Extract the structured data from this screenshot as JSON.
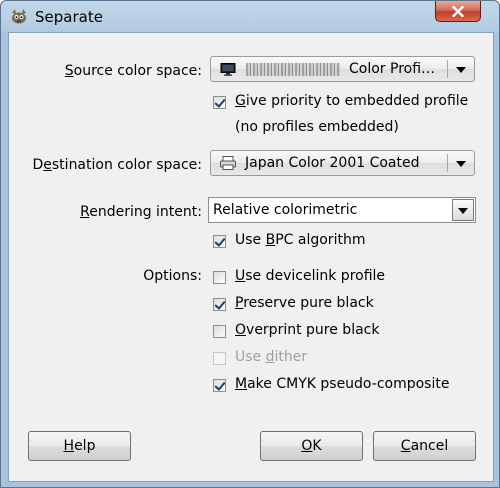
{
  "window": {
    "title": "Separate",
    "app_icon": "gimp-icon",
    "close_icon": "close-icon"
  },
  "source": {
    "label_pre": "",
    "label_u": "S",
    "label_post": "ource color space:",
    "value_suffix": "Color Profi…",
    "icon": "monitor-icon",
    "give_priority": {
      "checked": true,
      "pre": "",
      "u": "G",
      "post": "ive priority to embedded profile"
    },
    "note": "(no profiles embedded)"
  },
  "destination": {
    "label_pre": "D",
    "label_u": "e",
    "label_post": "stination color space:",
    "value": "Japan Color 2001 Coated",
    "icon": "printer-icon"
  },
  "rendering": {
    "label_pre": "",
    "label_u": "R",
    "label_post": "endering intent:",
    "value": "Relative colorimetric",
    "bpc": {
      "checked": true,
      "pre": "Use ",
      "u": "B",
      "post": "PC algorithm"
    }
  },
  "options": {
    "label": "Options:",
    "items": [
      {
        "pre": "",
        "u": "U",
        "post": "se devicelink profile",
        "checked": false,
        "disabled": false
      },
      {
        "pre": "",
        "u": "P",
        "post": "reserve pure black",
        "checked": true,
        "disabled": false
      },
      {
        "pre": "",
        "u": "O",
        "post": "verprint pure black",
        "checked": false,
        "disabled": false
      },
      {
        "pre": "Use ",
        "u": "d",
        "post": "ither",
        "checked": false,
        "disabled": true
      },
      {
        "pre": "",
        "u": "M",
        "post": "ake CMYK pseudo-composite",
        "checked": true,
        "disabled": false
      }
    ]
  },
  "buttons": {
    "help": {
      "pre": "",
      "u": "H",
      "post": "elp"
    },
    "ok": {
      "pre": "",
      "u": "O",
      "post": "K"
    },
    "cancel": {
      "pre": "",
      "u": "C",
      "post": "ancel"
    }
  }
}
